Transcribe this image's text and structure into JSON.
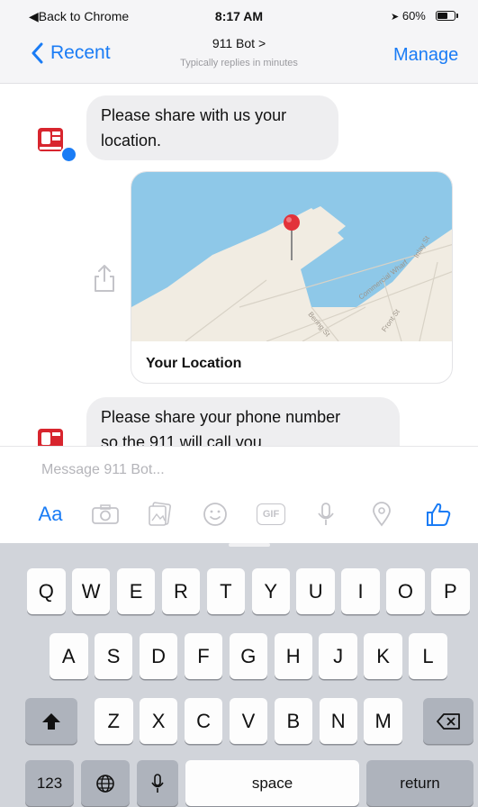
{
  "status_bar": {
    "back_label": "◀Back to Chrome",
    "time": "8:17 AM",
    "battery": "60%",
    "battery_level": 0.6
  },
  "nav": {
    "back_label": "Recent",
    "title": "911 Bot >",
    "subtitle": "Typically replies in minutes",
    "manage_label": "Manage"
  },
  "messages": [
    {
      "lines": [
        "Please share with us your",
        "location."
      ]
    },
    {
      "lines": [
        "Please share your phone number",
        "so the 911 will call you"
      ]
    }
  ],
  "location_card": {
    "label": "Your Location",
    "streets": [
      "Commercial Wharf",
      "Inlay St",
      "Bering St",
      "Front St"
    ]
  },
  "composer": {
    "placeholder": "Message 911 Bot...",
    "aa_label": "Aa",
    "gif_label": "GIF"
  },
  "keyboard": {
    "row1": [
      "Q",
      "W",
      "E",
      "R",
      "T",
      "Y",
      "U",
      "I",
      "O",
      "P"
    ],
    "row2": [
      "A",
      "S",
      "D",
      "F",
      "G",
      "H",
      "J",
      "K",
      "L"
    ],
    "row3": [
      "Z",
      "X",
      "C",
      "V",
      "B",
      "N",
      "M"
    ],
    "numbers_label": "123",
    "space_label": "space",
    "return_label": "return"
  },
  "colors": {
    "accent": "#1a7cf5",
    "bubble": "#eeeef0",
    "water": "#8ec8e8",
    "land": "#f1ece2",
    "pin": "#e2323a",
    "keyboard_bg": "#d1d4da"
  },
  "icons": [
    "chevron-left-icon",
    "share-icon",
    "camera-icon",
    "gallery-icon",
    "emoji-icon",
    "gif-icon",
    "microphone-icon",
    "location-pin-icon",
    "thumbs-up-icon",
    "shift-icon",
    "backspace-icon",
    "globe-icon",
    "keyboard-mic-icon"
  ]
}
